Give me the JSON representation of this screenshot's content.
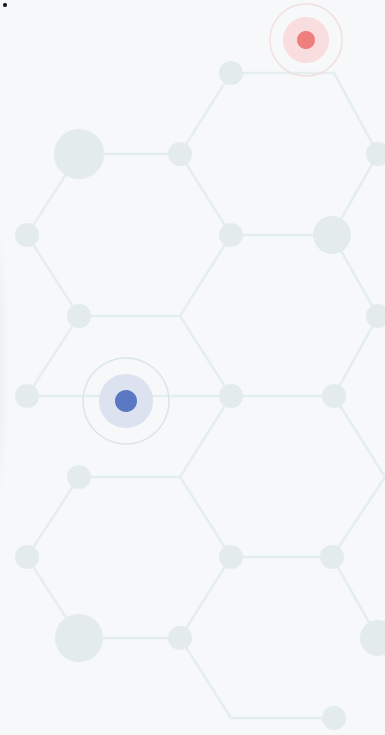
{
  "colors": {
    "background": "#f6f8f9",
    "network": "#e4eeee",
    "node": "#e3ebeb",
    "accent_red": "#ef7f7f",
    "accent_red_halo": "#f8dede",
    "accent_red_ring": "#f2e0e0",
    "accent_blue": "#5a79c2",
    "accent_blue_halo": "#dce2f0",
    "accent_blue_ring": "#d9e6e8"
  },
  "icons": {
    "corner": "dot-icon",
    "highlight_top": "red-target-dot-icon",
    "highlight_left": "blue-target-dot-icon"
  }
}
